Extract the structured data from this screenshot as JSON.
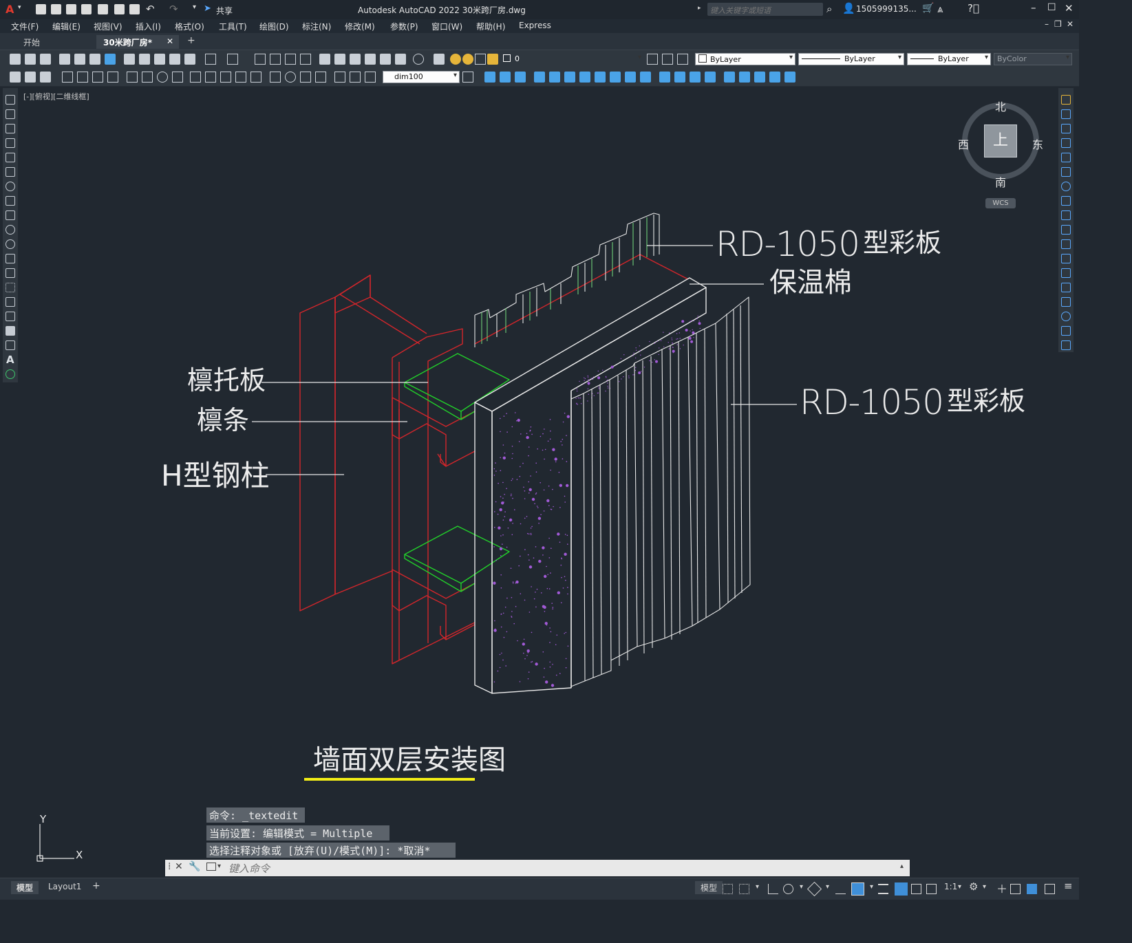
{
  "window": {
    "title": "Autodesk AutoCAD 2022    30米跨厂房.dwg",
    "share_label": "共享",
    "search_placeholder": "键入关键字或短语",
    "user": "1505999135...",
    "app_logo": "A"
  },
  "menu": [
    "文件(F)",
    "编辑(E)",
    "视图(V)",
    "插入(I)",
    "格式(O)",
    "工具(T)",
    "绘图(D)",
    "标注(N)",
    "修改(M)",
    "参数(P)",
    "窗口(W)",
    "帮助(H)",
    "Express"
  ],
  "tabs": {
    "start": "开始",
    "document": "30米跨厂房*",
    "close": "✕",
    "add": "+"
  },
  "toolbar": {
    "layer_value": "0",
    "color_value": "ByLayer",
    "linetype_value": "ByLayer",
    "lineweight_value": "ByLayer",
    "plotstyle_value": "ByColor",
    "dimstyle_value": "dim100"
  },
  "viewport": {
    "label": "[-][俯视][二维线框]"
  },
  "viewcube": {
    "north": "北",
    "south": "南",
    "east": "东",
    "west": "西",
    "face": "上",
    "wcs": "WCS"
  },
  "drawing": {
    "label_panel_top": "RD-1050",
    "label_panel_top_suffix": "型彩板",
    "label_insulation": "保温棉",
    "label_panel_right": "RD-1050",
    "label_panel_right_suffix": "型彩板",
    "label_purlin_bracket": "檩托板",
    "label_purlin": "檩条",
    "label_h_column": "H型钢柱",
    "title": "墙面双层安装图",
    "colors": {
      "steel": "#d4262b",
      "bracket": "#22d02a",
      "panel": "#e8e8e8",
      "underline": "#f3ee16",
      "speckle": "#a15ad6"
    }
  },
  "ucs": {
    "y": "Y",
    "x": "X"
  },
  "command": {
    "history": [
      "命令: _textedit",
      "当前设置: 编辑模式 = Multiple",
      "选择注释对象或 [放弃(U)/模式(M)]: *取消*"
    ],
    "placeholder": "键入命令"
  },
  "status": {
    "tab_model": "模型",
    "tab_layout1": "Layout1",
    "model_button": "模型",
    "scale": "1:1"
  }
}
